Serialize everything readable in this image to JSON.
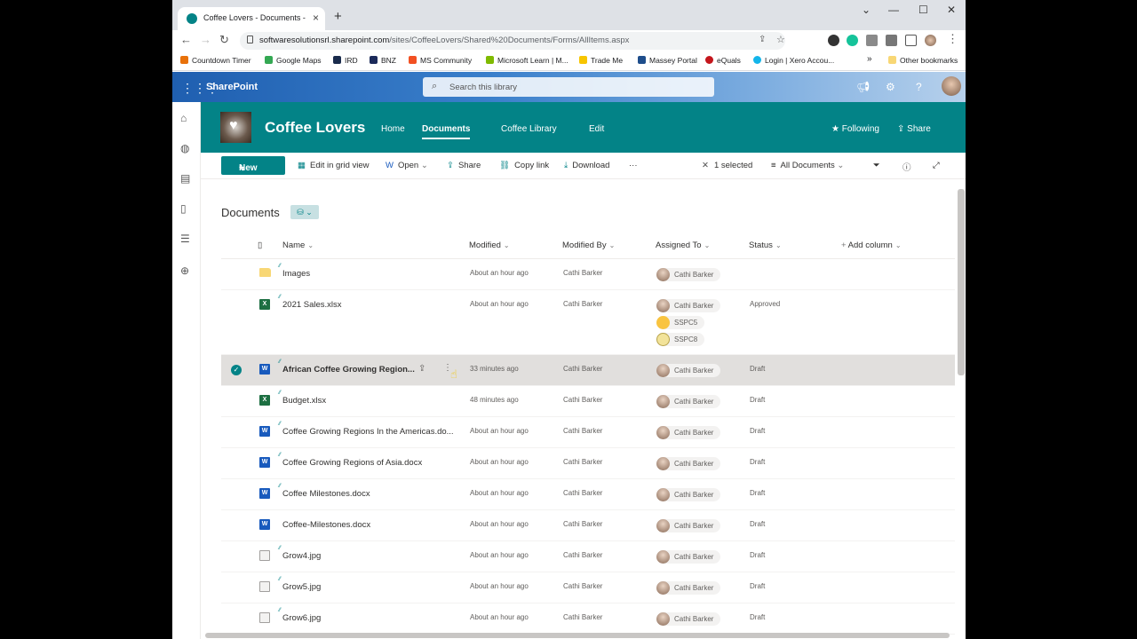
{
  "browser": {
    "tab_title": "Coffee Lovers - Documents - All",
    "tab_close": "×",
    "new_tab": "+",
    "window_controls": [
      "⌄",
      "—",
      "☐",
      "✕"
    ],
    "url_host": "softwaresolutionsrl.sharepoint.com",
    "url_path": "/sites/CoffeeLovers/Shared%20Documents/Forms/AllItems.aspx",
    "bookmarks": [
      {
        "label": "Countdown Timer",
        "color": "#e8710a"
      },
      {
        "label": "Google Maps",
        "color": "#34a853"
      },
      {
        "label": "IRD",
        "color": "#1a2b4c"
      },
      {
        "label": "BNZ",
        "color": "#1b2a5a"
      },
      {
        "label": "MS Community",
        "color": "#f25022"
      },
      {
        "label": "Microsoft Learn | M...",
        "color": "#7fba00"
      },
      {
        "label": "Trade Me",
        "color": "#f7c500"
      },
      {
        "label": "Massey Portal",
        "color": "#1e4d8b"
      },
      {
        "label": "eQuals",
        "color": "#c4161c"
      },
      {
        "label": "Login | Xero Accou...",
        "color": "#13b5ea"
      }
    ],
    "bookmarks_overflow": "»",
    "other_bookmarks": "Other bookmarks"
  },
  "suite": {
    "app_name": "SharePoint",
    "search_placeholder": "Search this library"
  },
  "site": {
    "title": "Coffee Lovers",
    "nav": [
      "Home",
      "Documents",
      "Coffee Library",
      "Edit"
    ],
    "following": "Following",
    "share": "Share",
    "accent": "#038387"
  },
  "commands": {
    "new": "New",
    "edit_grid": "Edit in grid view",
    "open": "Open",
    "share": "Share",
    "copy_link": "Copy link",
    "download": "Download",
    "more": "···",
    "selected": "1 selected",
    "view": "All Documents"
  },
  "library": {
    "title": "Documents",
    "columns": [
      "Name",
      "Modified",
      "Modified By",
      "Assigned To",
      "Status",
      "Add column"
    ],
    "rows": [
      {
        "name": "Images",
        "type": "folder",
        "modified": "About an hour ago",
        "by": "Cathi Barker",
        "assigned": [
          "Cathi Barker"
        ],
        "status": ""
      },
      {
        "name": "2021 Sales.xlsx",
        "type": "xlsx",
        "modified": "About an hour ago",
        "by": "Cathi Barker",
        "assigned": [
          "Cathi Barker",
          "SSPC5",
          "SSPC8"
        ],
        "status": "Approved"
      },
      {
        "name": "African Coffee Growing Region...",
        "type": "docx",
        "modified": "33 minutes ago",
        "by": "Cathi Barker",
        "assigned": [
          "Cathi Barker"
        ],
        "status": "Draft",
        "selected": true
      },
      {
        "name": "Budget.xlsx",
        "type": "xlsx",
        "modified": "48 minutes ago",
        "by": "Cathi Barker",
        "assigned": [
          "Cathi Barker"
        ],
        "status": "Draft"
      },
      {
        "name": "Coffee Growing Regions In the Americas.do...",
        "type": "docx",
        "modified": "About an hour ago",
        "by": "Cathi Barker",
        "assigned": [
          "Cathi Barker"
        ],
        "status": "Draft"
      },
      {
        "name": "Coffee Growing Regions of Asia.docx",
        "type": "docx",
        "modified": "About an hour ago",
        "by": "Cathi Barker",
        "assigned": [
          "Cathi Barker"
        ],
        "status": "Draft"
      },
      {
        "name": "Coffee Milestones.docx",
        "type": "docx",
        "modified": "About an hour ago",
        "by": "Cathi Barker",
        "assigned": [
          "Cathi Barker"
        ],
        "status": "Draft"
      },
      {
        "name": "Coffee-Milestones.docx",
        "type": "docx",
        "modified": "About an hour ago",
        "by": "Cathi Barker",
        "assigned": [
          "Cathi Barker"
        ],
        "status": "Draft"
      },
      {
        "name": "Grow4.jpg",
        "type": "jpg",
        "modified": "About an hour ago",
        "by": "Cathi Barker",
        "assigned": [
          "Cathi Barker"
        ],
        "status": "Draft"
      },
      {
        "name": "Grow5.jpg",
        "type": "jpg",
        "modified": "About an hour ago",
        "by": "Cathi Barker",
        "assigned": [
          "Cathi Barker"
        ],
        "status": "Draft"
      },
      {
        "name": "Grow6.jpg",
        "type": "jpg",
        "modified": "About an hour ago",
        "by": "Cathi Barker",
        "assigned": [
          "Cathi Barker"
        ],
        "status": "Draft"
      }
    ]
  }
}
